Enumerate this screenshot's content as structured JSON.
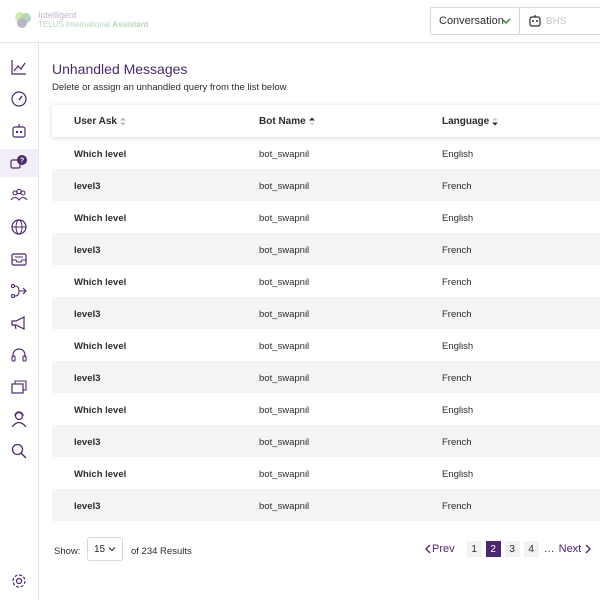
{
  "header": {
    "logo_line1": "Intelligent",
    "logo_line2_prefix": "TELUS International ",
    "logo_line2_bold": "Assistant",
    "view_select": "Conversation",
    "bot_select": "BHS"
  },
  "sidebar": {
    "items": [
      {
        "name": "analytics",
        "icon": "line-chart-icon"
      },
      {
        "name": "dashboard",
        "icon": "gauge-icon"
      },
      {
        "name": "bots",
        "icon": "robot-icon"
      },
      {
        "name": "unhandled-messages",
        "icon": "question-chat-icon",
        "active": true
      },
      {
        "name": "users",
        "icon": "users-icon"
      },
      {
        "name": "languages",
        "icon": "globe-icon"
      },
      {
        "name": "inbox",
        "icon": "inbox-icon"
      },
      {
        "name": "flows",
        "icon": "flow-icon"
      },
      {
        "name": "broadcast",
        "icon": "megaphone-icon"
      },
      {
        "name": "support",
        "icon": "headset-icon"
      },
      {
        "name": "content",
        "icon": "cards-icon"
      },
      {
        "name": "agents",
        "icon": "agent-icon"
      },
      {
        "name": "search",
        "icon": "search-icon"
      }
    ],
    "settings_icon": "gear-icon"
  },
  "main": {
    "title": "Unhandled Messages",
    "subtitle": "Delete or assign an unhandled query from the list below",
    "columns": [
      "User Ask",
      "Bot Name",
      "Language"
    ],
    "rows": [
      {
        "user_ask": "Which level",
        "bot_name": "bot_swapnil",
        "language": "English"
      },
      {
        "user_ask": "level3",
        "bot_name": "bot_swapnil",
        "language": "French"
      },
      {
        "user_ask": "Which level",
        "bot_name": "bot_swapnil",
        "language": "English"
      },
      {
        "user_ask": "level3",
        "bot_name": "bot_swapnil",
        "language": "French"
      },
      {
        "user_ask": "Which level",
        "bot_name": "bot_swapnil",
        "language": "French"
      },
      {
        "user_ask": "level3",
        "bot_name": "bot_swapnil",
        "language": "French"
      },
      {
        "user_ask": "Which level",
        "bot_name": "bot_swapnil",
        "language": "English"
      },
      {
        "user_ask": "level3",
        "bot_name": "bot_swapnil",
        "language": "French"
      },
      {
        "user_ask": "Which level",
        "bot_name": "bot_swapnil",
        "language": "English"
      },
      {
        "user_ask": "level3",
        "bot_name": "bot_swapnil",
        "language": "French"
      },
      {
        "user_ask": "Which level",
        "bot_name": "bot_swapnil",
        "language": "English"
      },
      {
        "user_ask": "level3",
        "bot_name": "bot_swapnil",
        "language": "French"
      }
    ]
  },
  "footer": {
    "show_label": "Show:",
    "page_size": "15",
    "results_text": "of  234 Results",
    "prev_label": "Prev",
    "next_label": "Next",
    "pages": [
      "1",
      "2",
      "3",
      "4"
    ],
    "current_page": "2",
    "ellipsis": "…"
  },
  "colors": {
    "brand_purple": "#4b286d",
    "brand_green": "#2a8a3a",
    "row_alt": "#f4f4f6"
  }
}
